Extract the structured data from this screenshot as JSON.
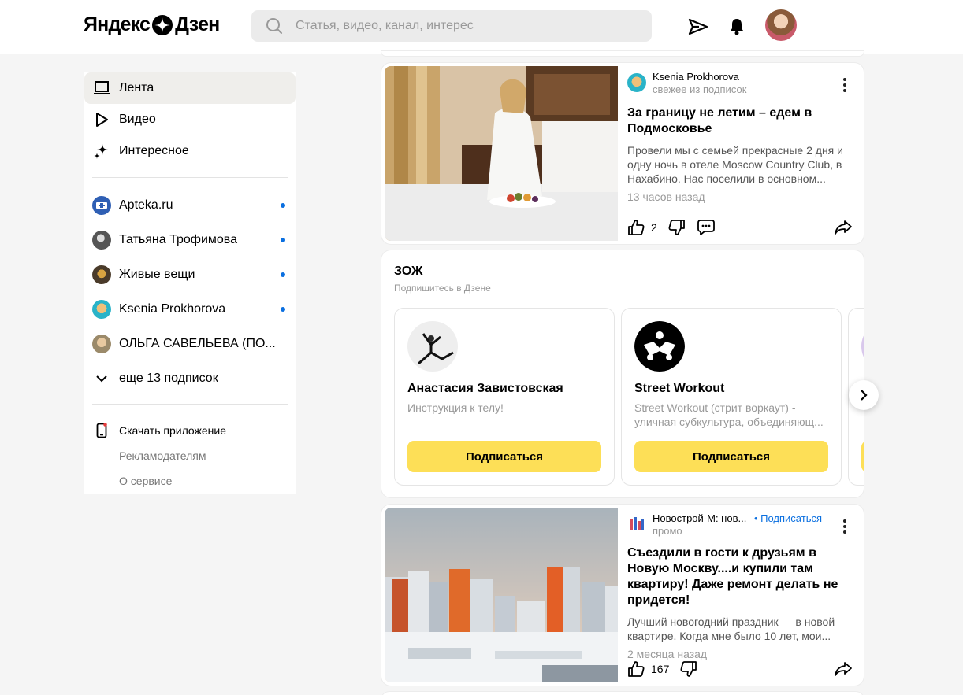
{
  "header": {
    "logo_left": "Яндекс",
    "logo_right": "Дзен",
    "search_placeholder": "Статья, видео, канал, интерес"
  },
  "sidebar": {
    "nav": [
      {
        "label": "Лента",
        "icon": "feed-icon",
        "active": true
      },
      {
        "label": "Видео",
        "icon": "play-icon",
        "active": false
      },
      {
        "label": "Интересное",
        "icon": "sparkle-icon",
        "active": false
      }
    ],
    "subscriptions": [
      {
        "label": "Apteka.ru",
        "has_new": true
      },
      {
        "label": "Татьяна Трофимова",
        "has_new": true
      },
      {
        "label": "Живые вещи",
        "has_new": true
      },
      {
        "label": "Ksenia Prokhorova",
        "has_new": true
      },
      {
        "label": "ОЛЬГА САВЕЛЬЕВА (ПО...",
        "has_new": false
      }
    ],
    "more_label": "еще 13 подписок",
    "download_app": "Скачать приложение",
    "advertisers": "Рекламодателям",
    "about": "О сервисе"
  },
  "feed": {
    "article1": {
      "source": "Ksenia Prokhorova",
      "source_sub": "свежее из подписок",
      "title": "За границу не летим – едем в Подмосковье",
      "snippet": "Провели мы с семьей прекрасные 2 дня и одну ночь в отеле Moscow Country Club, в Нахабино. Нас поселили в основном...",
      "time": "13 часов назад",
      "likes": "2"
    },
    "zozh": {
      "title": "ЗОЖ",
      "subtitle": "Подпишитесь в Дзене",
      "channels": [
        {
          "name": "Анастасия Завистовская",
          "desc": "Инструкция к телу!",
          "button": "Подписаться"
        },
        {
          "name": "Street Workout",
          "desc": "Street Workout (стрит воркаут) - уличная субкультура, объединяющ...",
          "button": "Подписаться"
        }
      ]
    },
    "article2": {
      "source": "Новострой-М: нов...",
      "subscribe": "• Подписаться",
      "source_sub": "промо",
      "title": "Съездили в гости к друзьям в Новую Москву....и купили там квартиру! Даже ремонт делать не придется!",
      "snippet": "Лучший новогодний праздник — в новой квартире. Когда мне было 10 лет, мои...",
      "time": "2 месяца назад",
      "likes": "167"
    }
  },
  "colors": {
    "accent_yellow": "#fddf57",
    "link_blue": "#0a6fe0",
    "active_bg": "#efeeeb"
  }
}
